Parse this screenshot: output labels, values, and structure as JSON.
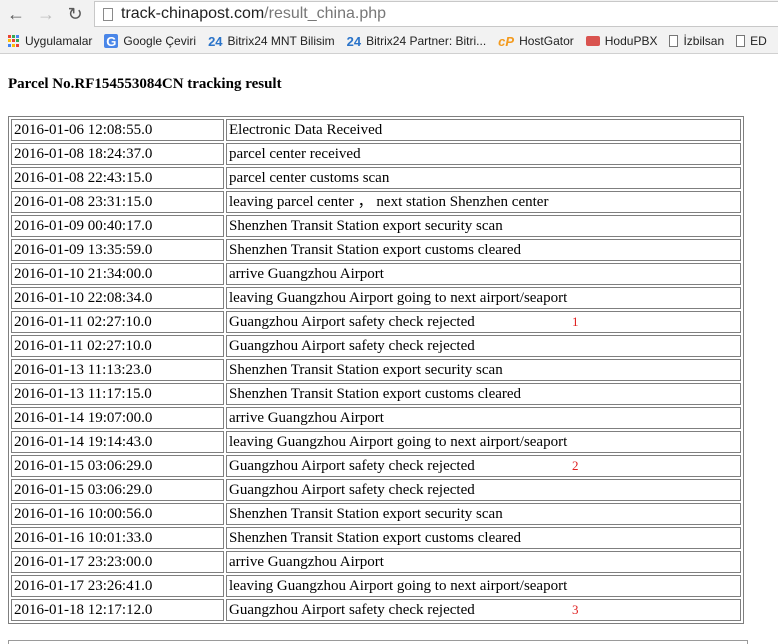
{
  "browser": {
    "url_host": "track-chinapost.com",
    "url_path": "/result_china.php",
    "bookmarks": [
      {
        "label": "Uygulamalar",
        "icon": "apps-grid-icon"
      },
      {
        "label": "Google Çeviri",
        "icon": "google-translate-icon"
      },
      {
        "label": "Bitrix24 MNT Bilisim",
        "icon": "bitrix24-icon"
      },
      {
        "label": "Bitrix24 Partner: Bitri...",
        "icon": "bitrix24-icon"
      },
      {
        "label": "HostGator",
        "icon": "cpanel-icon"
      },
      {
        "label": "HoduPBX",
        "icon": "hodupbx-icon"
      },
      {
        "label": "İzbilsan",
        "icon": "page-icon"
      },
      {
        "label": "ED",
        "icon": "page-icon"
      }
    ]
  },
  "page": {
    "heading": "Parcel No.RF154553084CN tracking result",
    "events": [
      {
        "time": "2016-01-06 12:08:55.0",
        "desc": "Electronic Data Received",
        "mark": ""
      },
      {
        "time": "2016-01-08 18:24:37.0",
        "desc": "parcel center received",
        "mark": ""
      },
      {
        "time": "2016-01-08 22:43:15.0",
        "desc": "parcel center customs scan",
        "mark": ""
      },
      {
        "time": "2016-01-08 23:31:15.0",
        "desc": "leaving parcel center ， next station Shenzhen center",
        "mark": ""
      },
      {
        "time": "2016-01-09 00:40:17.0",
        "desc": "Shenzhen Transit Station export security scan",
        "mark": ""
      },
      {
        "time": "2016-01-09 13:35:59.0",
        "desc": "Shenzhen Transit Station export customs cleared",
        "mark": ""
      },
      {
        "time": "2016-01-10 21:34:00.0",
        "desc": "arrive Guangzhou Airport",
        "mark": ""
      },
      {
        "time": "2016-01-10 22:08:34.0",
        "desc": "leaving Guangzhou Airport going to next airport/seaport",
        "mark": ""
      },
      {
        "time": "2016-01-11 02:27:10.0",
        "desc": "Guangzhou Airport safety check rejected",
        "mark": "1"
      },
      {
        "time": "2016-01-11 02:27:10.0",
        "desc": "Guangzhou Airport safety check rejected",
        "mark": ""
      },
      {
        "time": "2016-01-13 11:13:23.0",
        "desc": "Shenzhen Transit Station export security scan",
        "mark": ""
      },
      {
        "time": "2016-01-13 11:17:15.0",
        "desc": "Shenzhen Transit Station export customs cleared",
        "mark": ""
      },
      {
        "time": "2016-01-14 19:07:00.0",
        "desc": "arrive Guangzhou Airport",
        "mark": ""
      },
      {
        "time": "2016-01-14 19:14:43.0",
        "desc": "leaving Guangzhou Airport going to next airport/seaport",
        "mark": ""
      },
      {
        "time": "2016-01-15 03:06:29.0",
        "desc": "Guangzhou Airport safety check rejected",
        "mark": "2"
      },
      {
        "time": "2016-01-15 03:06:29.0",
        "desc": "Guangzhou Airport safety check rejected",
        "mark": ""
      },
      {
        "time": "2016-01-16 10:00:56.0",
        "desc": "Shenzhen Transit Station export security scan",
        "mark": ""
      },
      {
        "time": "2016-01-16 10:01:33.0",
        "desc": "Shenzhen Transit Station export customs cleared",
        "mark": ""
      },
      {
        "time": "2016-01-17 23:23:00.0",
        "desc": "arrive Guangzhou Airport",
        "mark": ""
      },
      {
        "time": "2016-01-17 23:26:41.0",
        "desc": "leaving Guangzhou Airport going to next airport/seaport",
        "mark": ""
      },
      {
        "time": "2016-01-18 12:17:12.0",
        "desc": "Guangzhou Airport safety check rejected",
        "mark": "3"
      }
    ]
  }
}
